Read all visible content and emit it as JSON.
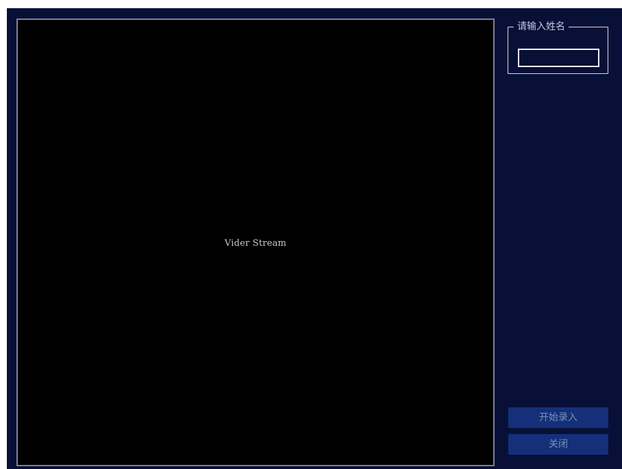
{
  "video": {
    "label": "Vider Stream"
  },
  "name_group": {
    "title": "请输入姓名",
    "input_value": ""
  },
  "buttons": {
    "start_label": "开始录入",
    "close_label": "关闭"
  },
  "colors": {
    "window_background": "#081038",
    "video_background": "#000000",
    "button_background": "#14307a",
    "button_text": "#7f8fb5",
    "group_border": "#d7dbe8"
  }
}
